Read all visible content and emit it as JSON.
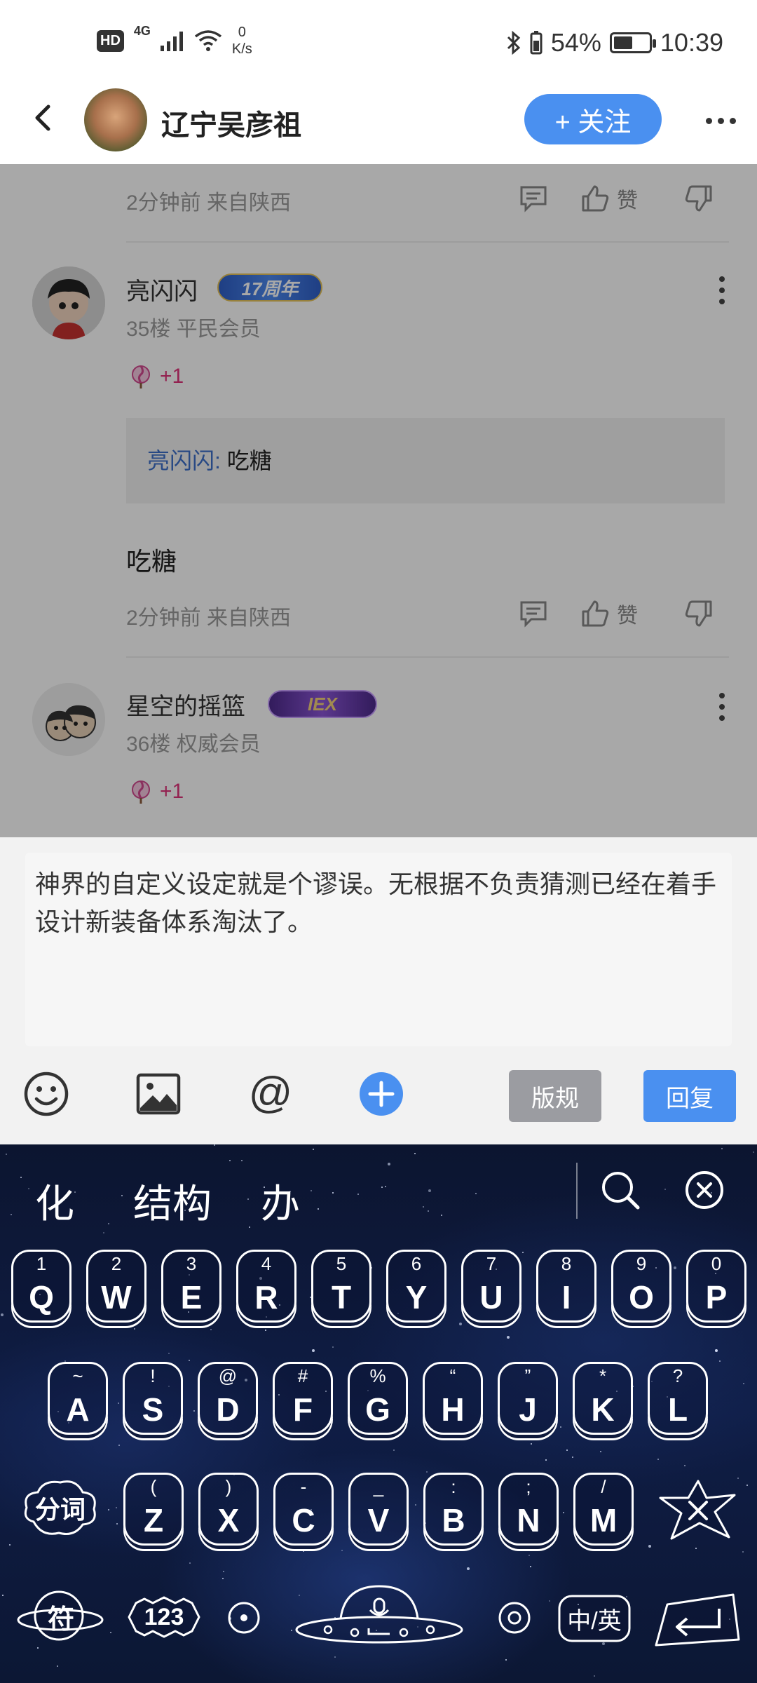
{
  "status_bar": {
    "hd": "HD",
    "network": "4G",
    "net_speed_value": "0",
    "net_speed_unit": "K/s",
    "battery_text": "54%",
    "battery_level": 0.54,
    "time": "10:39"
  },
  "header": {
    "title": "辽宁吴彦祖",
    "follow_label": "+ 关注"
  },
  "thread": {
    "top_meta": {
      "time_location": "2分钟前 来自陕西",
      "like_label": "赞"
    },
    "comment_1": {
      "name": "亮闪闪",
      "badge": "17周年",
      "floor_info": "35楼 平民会员",
      "gift": "+1",
      "quote_name": "亮闪闪:",
      "quote_text": "吃糖",
      "text": "吃糖",
      "time_location": "2分钟前 来自陕西",
      "like_label": "赞"
    },
    "comment_2": {
      "name": "星空的摇篮",
      "badge": "IEX",
      "floor_info": "36楼 权威会员",
      "gift": "+1"
    }
  },
  "composer": {
    "input_text": "神界的自定义设定就是个谬误。无根据不负责猜测已经在着手设计新装备体系淘汰了。",
    "rules_label": "版规",
    "reply_label": "回复"
  },
  "keyboard": {
    "candidates": [
      "化",
      "结构",
      "办"
    ],
    "row1": [
      {
        "sym": "1",
        "ltr": "Q"
      },
      {
        "sym": "2",
        "ltr": "W"
      },
      {
        "sym": "3",
        "ltr": "E"
      },
      {
        "sym": "4",
        "ltr": "R"
      },
      {
        "sym": "5",
        "ltr": "T"
      },
      {
        "sym": "6",
        "ltr": "Y"
      },
      {
        "sym": "7",
        "ltr": "U"
      },
      {
        "sym": "8",
        "ltr": "I"
      },
      {
        "sym": "9",
        "ltr": "O"
      },
      {
        "sym": "0",
        "ltr": "P"
      }
    ],
    "row2": [
      {
        "sym": "~",
        "ltr": "A"
      },
      {
        "sym": "!",
        "ltr": "S"
      },
      {
        "sym": "@",
        "ltr": "D"
      },
      {
        "sym": "#",
        "ltr": "F"
      },
      {
        "sym": "%",
        "ltr": "G"
      },
      {
        "sym": "“",
        "ltr": "H"
      },
      {
        "sym": "”",
        "ltr": "J"
      },
      {
        "sym": "*",
        "ltr": "K"
      },
      {
        "sym": "?",
        "ltr": "L"
      }
    ],
    "row3": [
      {
        "sym": "(",
        "ltr": "Z"
      },
      {
        "sym": ")",
        "ltr": "X"
      },
      {
        "sym": "-",
        "ltr": "C"
      },
      {
        "sym": "_",
        "ltr": "V"
      },
      {
        "sym": ":",
        "ltr": "B"
      },
      {
        "sym": ";",
        "ltr": "N"
      },
      {
        "sym": "/",
        "ltr": "M"
      }
    ],
    "fenci_label": "分词",
    "symbol_label": "符",
    "num_label": "123",
    "lang_label": "中/英",
    "comma": ",",
    "period": "。"
  },
  "colors": {
    "accent": "#4a90f0",
    "rules_button": "#9b9ca1",
    "badge_blue": "#3a6fd8",
    "badge_purple": "#7a46c8",
    "gift_pink": "#e0327a",
    "quote_link": "#3d6fc9"
  }
}
